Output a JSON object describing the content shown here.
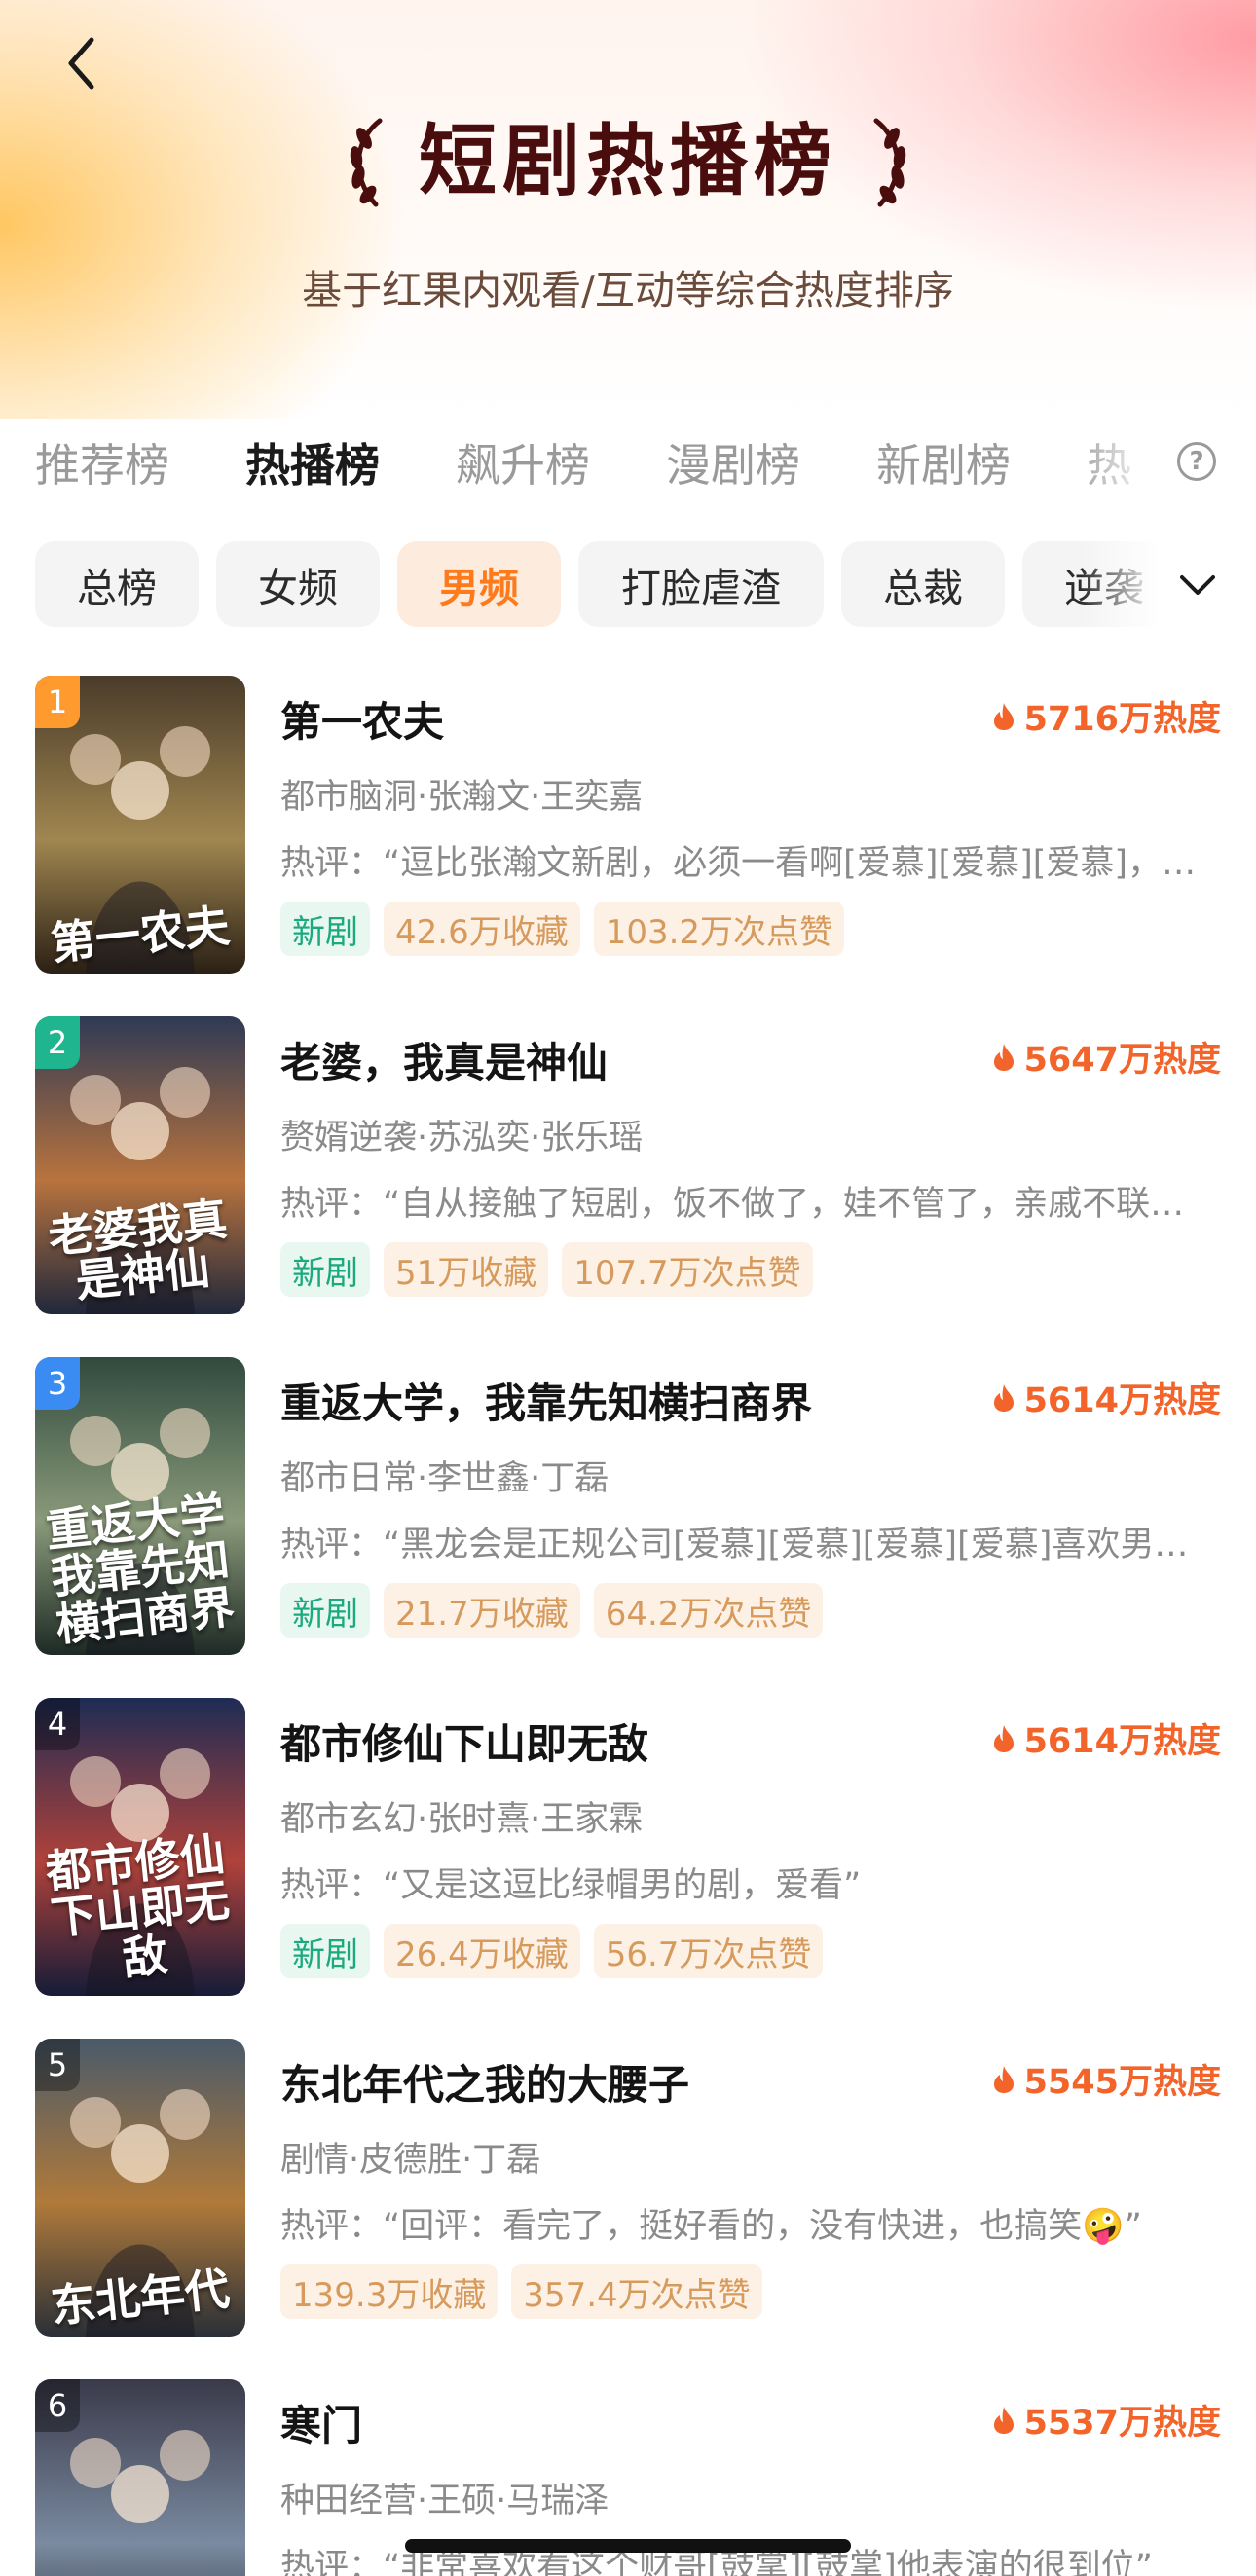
{
  "header": {
    "title": "短剧热播榜",
    "subtitle": "基于红果内观看/互动等综合热度排序"
  },
  "tabs": [
    {
      "label": "推荐榜",
      "active": false
    },
    {
      "label": "热播榜",
      "active": true
    },
    {
      "label": "飙升榜",
      "active": false
    },
    {
      "label": "漫剧榜",
      "active": false
    },
    {
      "label": "新剧榜",
      "active": false
    },
    {
      "label": "热",
      "active": false
    }
  ],
  "chips": [
    {
      "label": "总榜",
      "active": false
    },
    {
      "label": "女频",
      "active": false
    },
    {
      "label": "男频",
      "active": true
    },
    {
      "label": "打脸虐渣",
      "active": false
    },
    {
      "label": "总裁",
      "active": false
    },
    {
      "label": "逆袭",
      "active": false
    }
  ],
  "colors": {
    "accent": "#ff7a1a",
    "heat": "#f2642a",
    "new_tag": "#1ca97e",
    "stat_tag": "#d69a5c",
    "rank_1": "#ff9a2e",
    "rank_2": "#1fb58f",
    "rank_3": "#3b8cf2",
    "rank_other": "rgba(0,0,0,0.35)"
  },
  "icons": [
    "back-arrow-icon",
    "laurel-left-icon",
    "laurel-right-icon",
    "help-icon",
    "chevron-down-icon",
    "flame-icon"
  ],
  "list": [
    {
      "rank": "1",
      "title": "第一农夫",
      "heat": "5716万热度",
      "meta": "都市脑洞·张瀚文·王奕嘉",
      "comment": "热评：“逗比张瀚文新剧，必须一看啊[爱慕][爱慕][爱慕]，……",
      "poster_title": "第一农夫",
      "tags": [
        {
          "label": "新剧",
          "kind": "new"
        },
        {
          "label": "42.6万收藏",
          "kind": "stat"
        },
        {
          "label": "103.2万次点赞",
          "kind": "stat"
        }
      ]
    },
    {
      "rank": "2",
      "title": "老婆，我真是神仙",
      "heat": "5647万热度",
      "meta": "赘婿逆袭·苏泓奕·张乐瑶",
      "comment": "热评：“自从接触了短剧，饭不做了，娃不管了，亲戚不联…",
      "poster_title": "老婆我真是神仙",
      "tags": [
        {
          "label": "新剧",
          "kind": "new"
        },
        {
          "label": "51万收藏",
          "kind": "stat"
        },
        {
          "label": "107.7万次点赞",
          "kind": "stat"
        }
      ]
    },
    {
      "rank": "3",
      "title": "重返大学，我靠先知横扫商界",
      "heat": "5614万热度",
      "meta": "都市日常·李世鑫·丁磊",
      "comment": "热评：“黑龙会是正规公司[爱慕][爱慕][爱慕][爱慕]喜欢男…",
      "poster_title": "重返大学 我靠先知横扫商界",
      "tags": [
        {
          "label": "新剧",
          "kind": "new"
        },
        {
          "label": "21.7万收藏",
          "kind": "stat"
        },
        {
          "label": "64.2万次点赞",
          "kind": "stat"
        }
      ]
    },
    {
      "rank": "4",
      "title": "都市修仙下山即无敌",
      "heat": "5614万热度",
      "meta": "都市玄幻·张时熹·王家霖",
      "comment": "热评：“又是这逗比绿帽男的剧，爱看”",
      "poster_title": "都市修仙 下山即无敌",
      "tags": [
        {
          "label": "新剧",
          "kind": "new"
        },
        {
          "label": "26.4万收藏",
          "kind": "stat"
        },
        {
          "label": "56.7万次点赞",
          "kind": "stat"
        }
      ]
    },
    {
      "rank": "5",
      "title": "东北年代之我的大腰子",
      "heat": "5545万热度",
      "meta": "剧情·皮德胜·丁磊",
      "comment": "热评：“回评：看完了，挺好看的，没有快进，也搞笑🤪”",
      "poster_title": "东北年代",
      "tags": [
        {
          "label": "139.3万收藏",
          "kind": "stat"
        },
        {
          "label": "357.4万次点赞",
          "kind": "stat"
        }
      ]
    },
    {
      "rank": "6",
      "title": "寒门",
      "heat": "5537万热度",
      "meta": "种田经营·王硕·马瑞泽",
      "comment": "热评：“非常喜欢看这个财哥[鼓掌][鼓掌]他表演的很到位”",
      "poster_title": "",
      "tags": []
    }
  ]
}
